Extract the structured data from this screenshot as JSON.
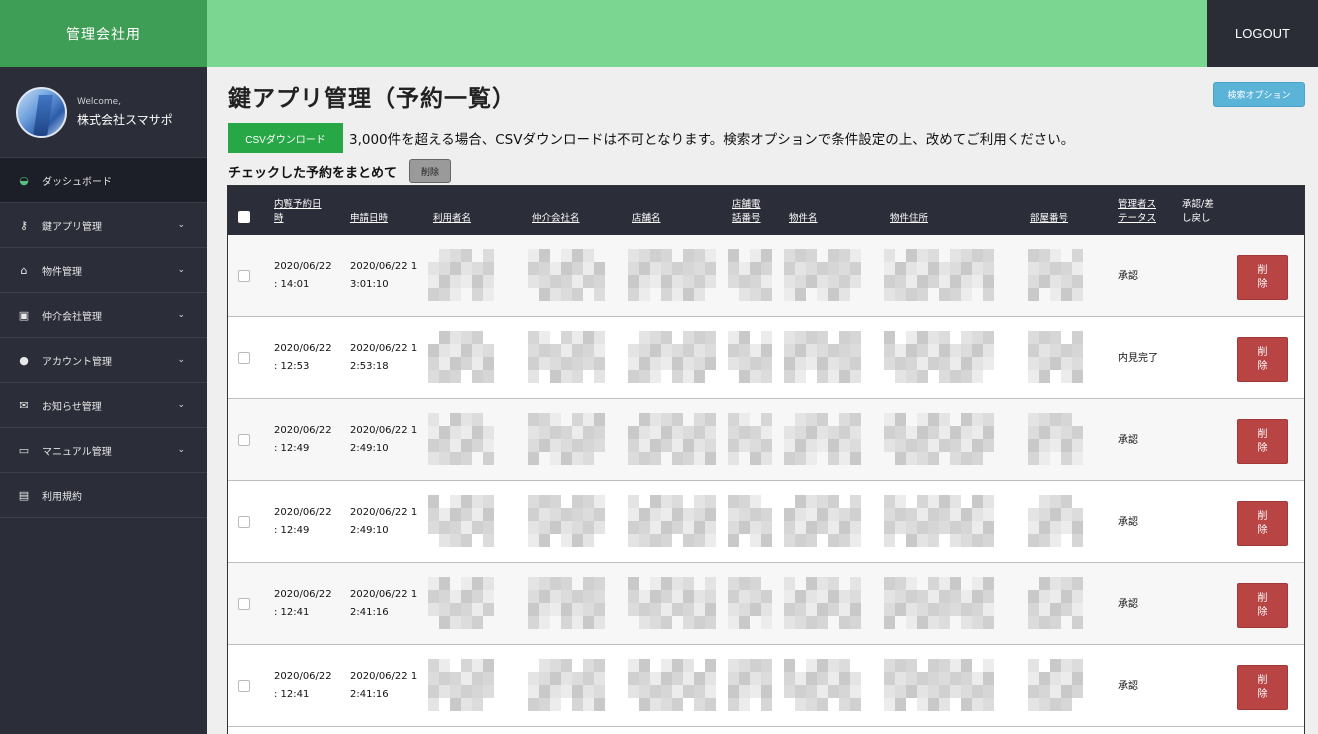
{
  "app": {
    "brand": "管理会社用",
    "logout": "LOGOUT"
  },
  "profile": {
    "welcome": "Welcome,",
    "name": "株式会社スマサポ"
  },
  "sidebar": {
    "items": [
      {
        "label": "ダッシュボード",
        "icon": "dashboard-icon",
        "glyph": "◒",
        "chevron": ""
      },
      {
        "label": "鍵アプリ管理",
        "icon": "key-icon",
        "glyph": "⚷",
        "chevron": "⌄"
      },
      {
        "label": "物件管理",
        "icon": "home-icon",
        "glyph": "⌂",
        "chevron": "⌄"
      },
      {
        "label": "仲介会社管理",
        "icon": "briefcase-icon",
        "glyph": "▣",
        "chevron": "⌄"
      },
      {
        "label": "アカウント管理",
        "icon": "user-icon",
        "glyph": "●",
        "chevron": "⌄"
      },
      {
        "label": "お知らせ管理",
        "icon": "envelope-icon",
        "glyph": "✉",
        "chevron": "⌄"
      },
      {
        "label": "マニュアル管理",
        "icon": "inbox-icon",
        "glyph": "▭",
        "chevron": "⌄"
      },
      {
        "label": "利用規約",
        "icon": "document-icon",
        "glyph": "▤",
        "chevron": ""
      }
    ]
  },
  "page": {
    "title": "鍵アプリ管理（予約一覧）",
    "search_option": "検索オプション",
    "csv_button": "CSVダウンロード",
    "csv_note": "3,000件を超える場合、CSVダウンロードは不可となります。検索オプションで条件設定の上、改めてご利用ください。",
    "bulk_label": "チェックした予約をまとめて",
    "bulk_delete": "削除"
  },
  "table": {
    "headers": {
      "viewing_datetime_1": "内覧予約日",
      "viewing_datetime_2": "時",
      "applied_at": "申請日時",
      "user_name": "利用者名",
      "agency_name": "仲介会社名",
      "store_name": "店舗名",
      "store_phone_1": "店舗電",
      "store_phone_2": "話番号",
      "property_name": "物件名",
      "property_address": "物件住所",
      "room_number": "部屋番号",
      "admin_status_1": "管理者ス",
      "admin_status_2": "テータス",
      "approval_1": "承認/差",
      "approval_2": "し戻し"
    },
    "delete_label_1": "削",
    "delete_label_2": "除",
    "rows": [
      {
        "view_date": "2020/06/22",
        "view_time": ": 14:01",
        "applied_1": "2020/06/22 1",
        "applied_2": "3:01:10",
        "status": "承認"
      },
      {
        "view_date": "2020/06/22",
        "view_time": ": 12:53",
        "applied_1": "2020/06/22 1",
        "applied_2": "2:53:18",
        "status": "内見完了"
      },
      {
        "view_date": "2020/06/22",
        "view_time": ": 12:49",
        "applied_1": "2020/06/22 1",
        "applied_2": "2:49:10",
        "status": "承認"
      },
      {
        "view_date": "2020/06/22",
        "view_time": ": 12:49",
        "applied_1": "2020/06/22 1",
        "applied_2": "2:49:10",
        "status": "承認"
      },
      {
        "view_date": "2020/06/22",
        "view_time": ": 12:41",
        "applied_1": "2020/06/22 1",
        "applied_2": "2:41:16",
        "status": "承認"
      },
      {
        "view_date": "2020/06/22",
        "view_time": ": 12:41",
        "applied_1": "2020/06/22 1",
        "applied_2": "2:41:16",
        "status": "承認"
      }
    ]
  }
}
